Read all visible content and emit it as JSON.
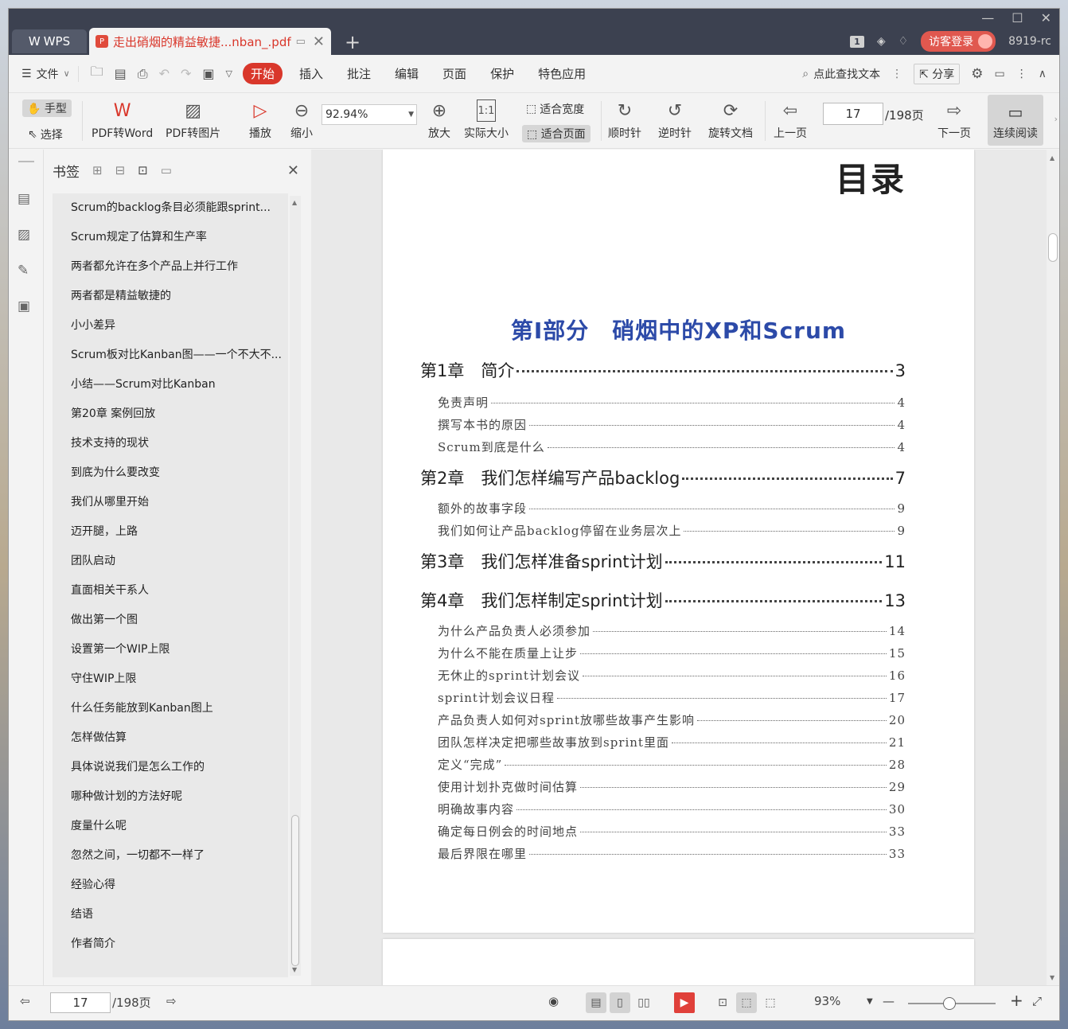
{
  "titlebar": {
    "app_tab": "WPS",
    "doc_tab": "走出硝烟的精益敏捷...nban_.pdf",
    "badge": "1",
    "visitor_login": "访客登录",
    "user_id": "8919-rc"
  },
  "menubar": {
    "file": "文件",
    "tabs": [
      "开始",
      "插入",
      "批注",
      "编辑",
      "页面",
      "保护",
      "特色应用"
    ],
    "search": "点此查找文本",
    "share": "分享"
  },
  "ribbon": {
    "hand": "手型",
    "select": "选择",
    "pdf_to_word": "PDF转Word",
    "pdf_to_image": "PDF转图片",
    "play": "播放",
    "zoom_out": "缩小",
    "zoom_value": "92.94%",
    "zoom_in": "放大",
    "actual_size": "实际大小",
    "fit_width": "适合宽度",
    "fit_page": "适合页面",
    "clockwise": "顺时针",
    "counterclockwise": "逆时针",
    "rotate_doc": "旋转文档",
    "prev_page": "上一页",
    "page_current": "17",
    "page_total": "/198页",
    "next_page": "下一页",
    "continuous": "连续阅读"
  },
  "bookmarks": {
    "title": "书签",
    "items": [
      "Scrum的backlog条目必须能跟sprint...",
      "Scrum规定了估算和生产率",
      "两者都允许在多个产品上并行工作",
      "两者都是精益敏捷的",
      "小小差异",
      "Scrum板对比Kanban图——一个不大不...",
      "小结——Scrum对比Kanban",
      "第20章 案例回放",
      "技术支持的现状",
      "到底为什么要改变",
      "我们从哪里开始",
      "迈开腿，上路",
      "团队启动",
      "直面相关干系人",
      "做出第一个图",
      "设置第一个WIP上限",
      "守住WIP上限",
      "什么任务能放到Kanban图上",
      "怎样做估算",
      "具体说说我们是怎么工作的",
      "哪种做计划的方法好呢",
      "度量什么呢",
      "忽然之间，一切都不一样了",
      "经验心得",
      "结语",
      "作者简介"
    ]
  },
  "document": {
    "heading": "目录",
    "part": "第Ⅰ部分　硝烟中的XP和Scrum",
    "entries": [
      {
        "kind": "ch",
        "text": "第1章　简介",
        "page": "3"
      },
      {
        "kind": "sub",
        "text": "免责声明",
        "page": "4"
      },
      {
        "kind": "sub",
        "text": "撰写本书的原因",
        "page": "4"
      },
      {
        "kind": "sub",
        "text": "Scrum到底是什么",
        "page": "4"
      },
      {
        "kind": "ch",
        "text": "第2章　我们怎样编写产品backlog",
        "page": "7"
      },
      {
        "kind": "sub",
        "text": "额外的故事字段",
        "page": "9"
      },
      {
        "kind": "sub",
        "text": "我们如何让产品backlog停留在业务层次上",
        "page": "9"
      },
      {
        "kind": "ch",
        "text": "第3章　我们怎样准备sprint计划",
        "page": "11"
      },
      {
        "kind": "ch",
        "text": "第4章　我们怎样制定sprint计划",
        "page": "13"
      },
      {
        "kind": "sub",
        "text": "为什么产品负责人必须参加",
        "page": "14"
      },
      {
        "kind": "sub",
        "text": "为什么不能在质量上让步",
        "page": "15"
      },
      {
        "kind": "sub",
        "text": "无休止的sprint计划会议",
        "page": "16"
      },
      {
        "kind": "sub",
        "text": "sprint计划会议日程",
        "page": "17"
      },
      {
        "kind": "sub",
        "text": "产品负责人如何对sprint放哪些故事产生影响",
        "page": "20"
      },
      {
        "kind": "sub",
        "text": "团队怎样决定把哪些故事放到sprint里面",
        "page": "21"
      },
      {
        "kind": "sub",
        "text": "定义“完成”",
        "page": "28"
      },
      {
        "kind": "sub",
        "text": "使用计划扑克做时间估算",
        "page": "29"
      },
      {
        "kind": "sub",
        "text": "明确故事内容",
        "page": "30"
      },
      {
        "kind": "sub",
        "text": "确定每日例会的时间地点",
        "page": "33"
      },
      {
        "kind": "sub",
        "text": "最后界限在哪里",
        "page": "33"
      }
    ]
  },
  "statusbar": {
    "page_current": "17",
    "page_total": "/198页",
    "zoom": "93%"
  }
}
